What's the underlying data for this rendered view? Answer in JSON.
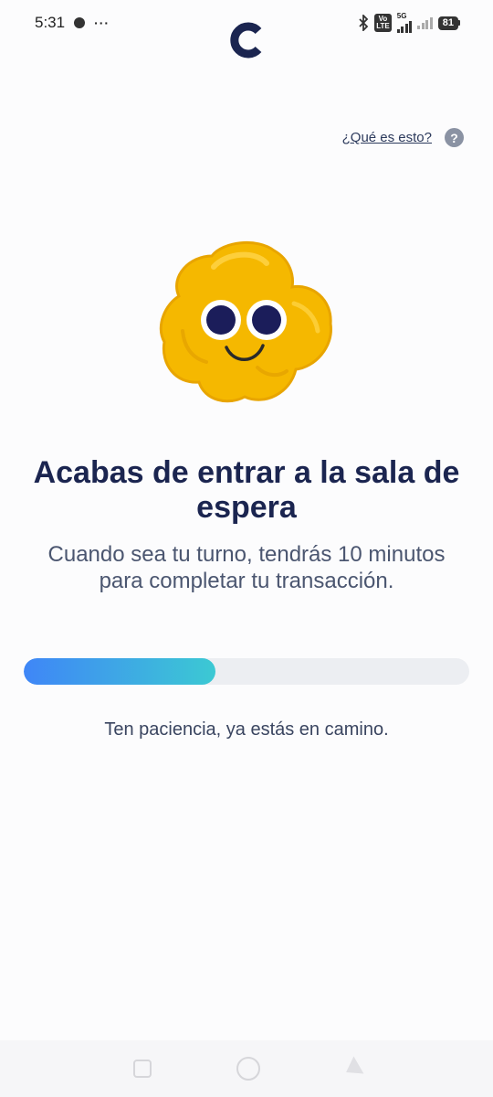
{
  "status_bar": {
    "time": "5:31",
    "more": "···",
    "volte_top": "Vo",
    "volte_bottom": "LTE",
    "network": "5G",
    "battery": "81"
  },
  "header": {
    "help_link": "¿Qué es esto?",
    "help_icon_glyph": "?"
  },
  "main": {
    "title": "Acabas de entrar a la sala de espera",
    "subtitle": "Cuando sea tu turno, tendrás 10 minutos para completar tu transacción.",
    "progress_fraction": 0.43,
    "patience_text": "Ten paciencia, ya estás en camino."
  },
  "colors": {
    "brand_navy": "#1b2550",
    "progress_start": "#3f86f7",
    "progress_end": "#3cc9d3",
    "mascot_yellow": "#f5b800"
  },
  "icons": [
    "chat-icon",
    "bluetooth-icon",
    "volte-icon",
    "signal-icon",
    "battery-icon",
    "logo-icon",
    "help-icon",
    "mascot-icon"
  ]
}
